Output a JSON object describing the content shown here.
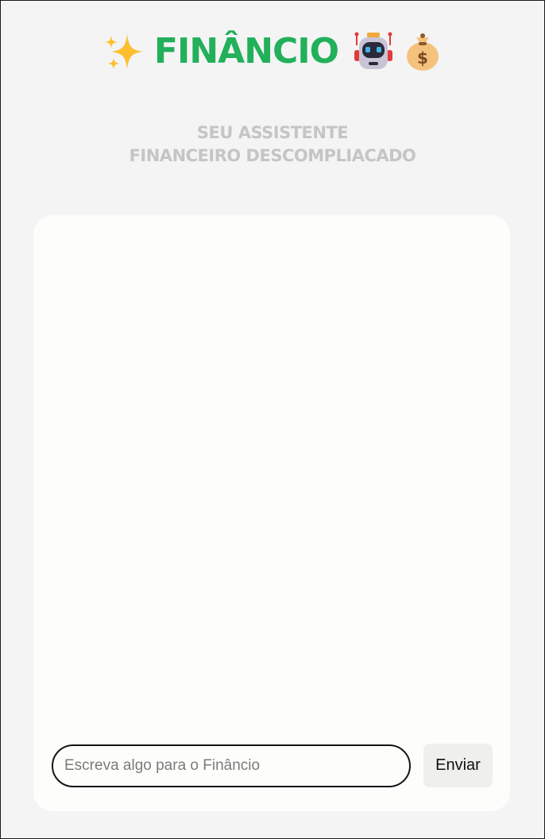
{
  "header": {
    "title": "FINÂNCIO",
    "icons": [
      "sparkles-icon",
      "robot-icon",
      "money-bag-icon"
    ]
  },
  "subtitle": {
    "line1": "SEU ASSISTENTE",
    "line2": "FINANCEIRO DESCOMPLIACADO"
  },
  "chat": {
    "input_placeholder": "Escreva algo para o Finâncio",
    "input_value": "",
    "send_label": "Enviar"
  },
  "colors": {
    "brand_green": "#22b05a",
    "subtitle_gray": "#c5c5c5",
    "page_background": "#f4f4f5",
    "card_background": "#fdfdfb"
  }
}
